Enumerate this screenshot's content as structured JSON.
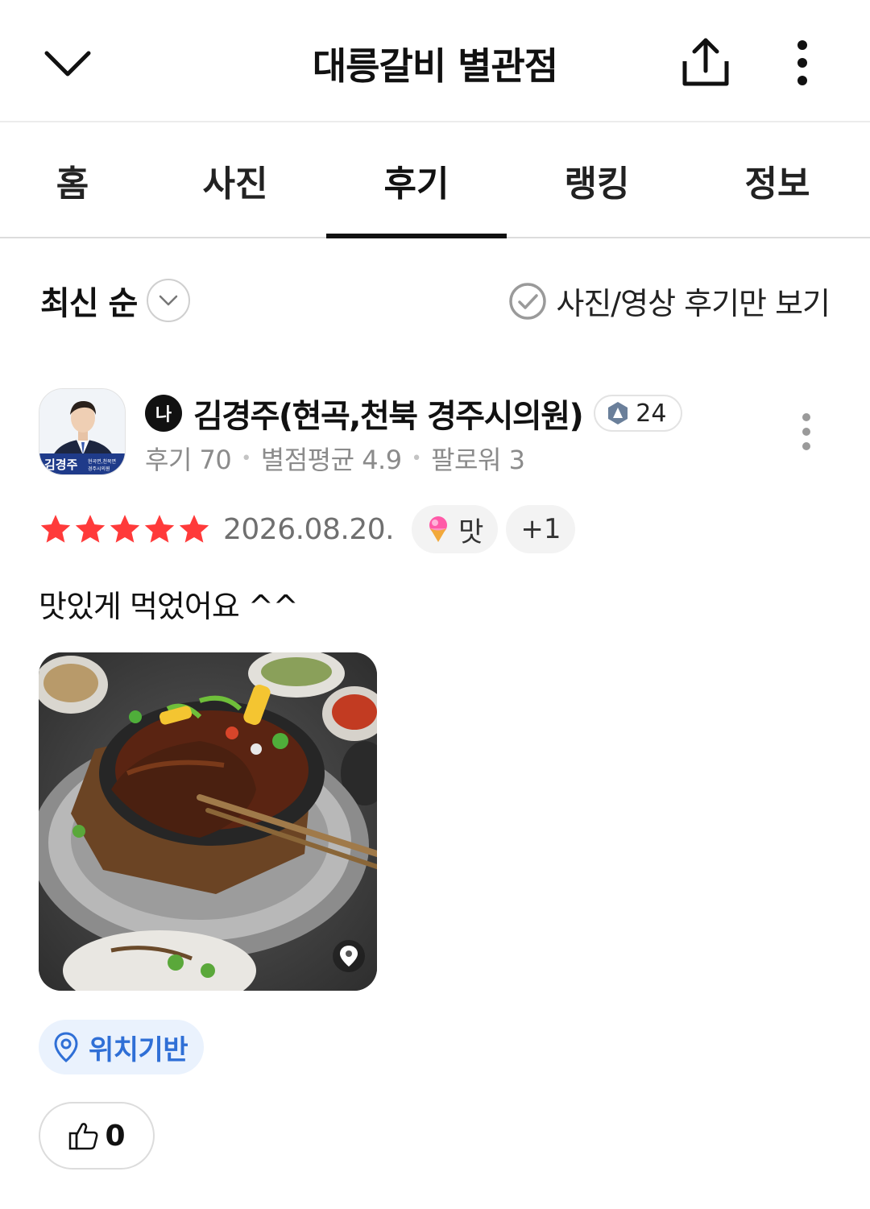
{
  "header": {
    "title": "대릉갈비 별관점",
    "back_icon": "chevron-down-icon",
    "share_icon": "share-icon",
    "more_icon": "more-vertical-icon"
  },
  "tabs": [
    {
      "label": "홈",
      "active": false
    },
    {
      "label": "사진",
      "active": false
    },
    {
      "label": "후기",
      "active": true
    },
    {
      "label": "랭킹",
      "active": false
    },
    {
      "label": "정보",
      "active": false
    }
  ],
  "filters": {
    "sort_label": "최신 순",
    "photo_only_label": "사진/영상 후기만 보기"
  },
  "review": {
    "reviewer": {
      "level_badge": "나",
      "name": "김경주(현곡,천북 경주시의원)",
      "grade": "24",
      "avatar_caption": "김경주",
      "avatar_small_text": "현곡면,천북면 경주시의원",
      "stats": {
        "reviews": "후기 70",
        "average": "별점평균 4.9",
        "followers": "팔로워 3"
      }
    },
    "rating": 5,
    "date": "2026.08.20.",
    "tags": [
      {
        "icon": "ice-cream-icon",
        "label": "맛"
      },
      {
        "icon": "",
        "label": "+1"
      }
    ],
    "text": "맛있게 먹었어요 ^^",
    "photo_icon": "location-pin-icon",
    "location_badge": "위치기반",
    "likes": "0"
  },
  "colors": {
    "star": "#ff3a3a",
    "location_badge_bg": "#eaf2fd",
    "location_badge_text": "#2f6fd6",
    "tab_active_underline": "#111111"
  }
}
